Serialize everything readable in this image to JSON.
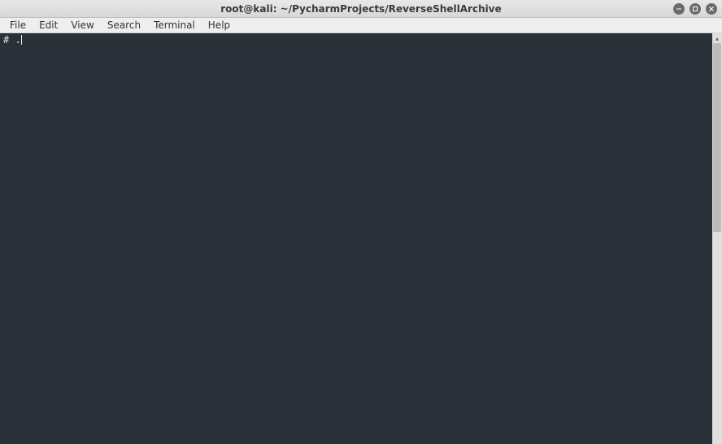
{
  "window": {
    "title": "root@kali: ~/PycharmProjects/ReverseShellArchive"
  },
  "menu": {
    "items": [
      "File",
      "Edit",
      "View",
      "Search",
      "Terminal",
      "Help"
    ]
  },
  "terminal": {
    "prompt": "# ",
    "command": "."
  }
}
